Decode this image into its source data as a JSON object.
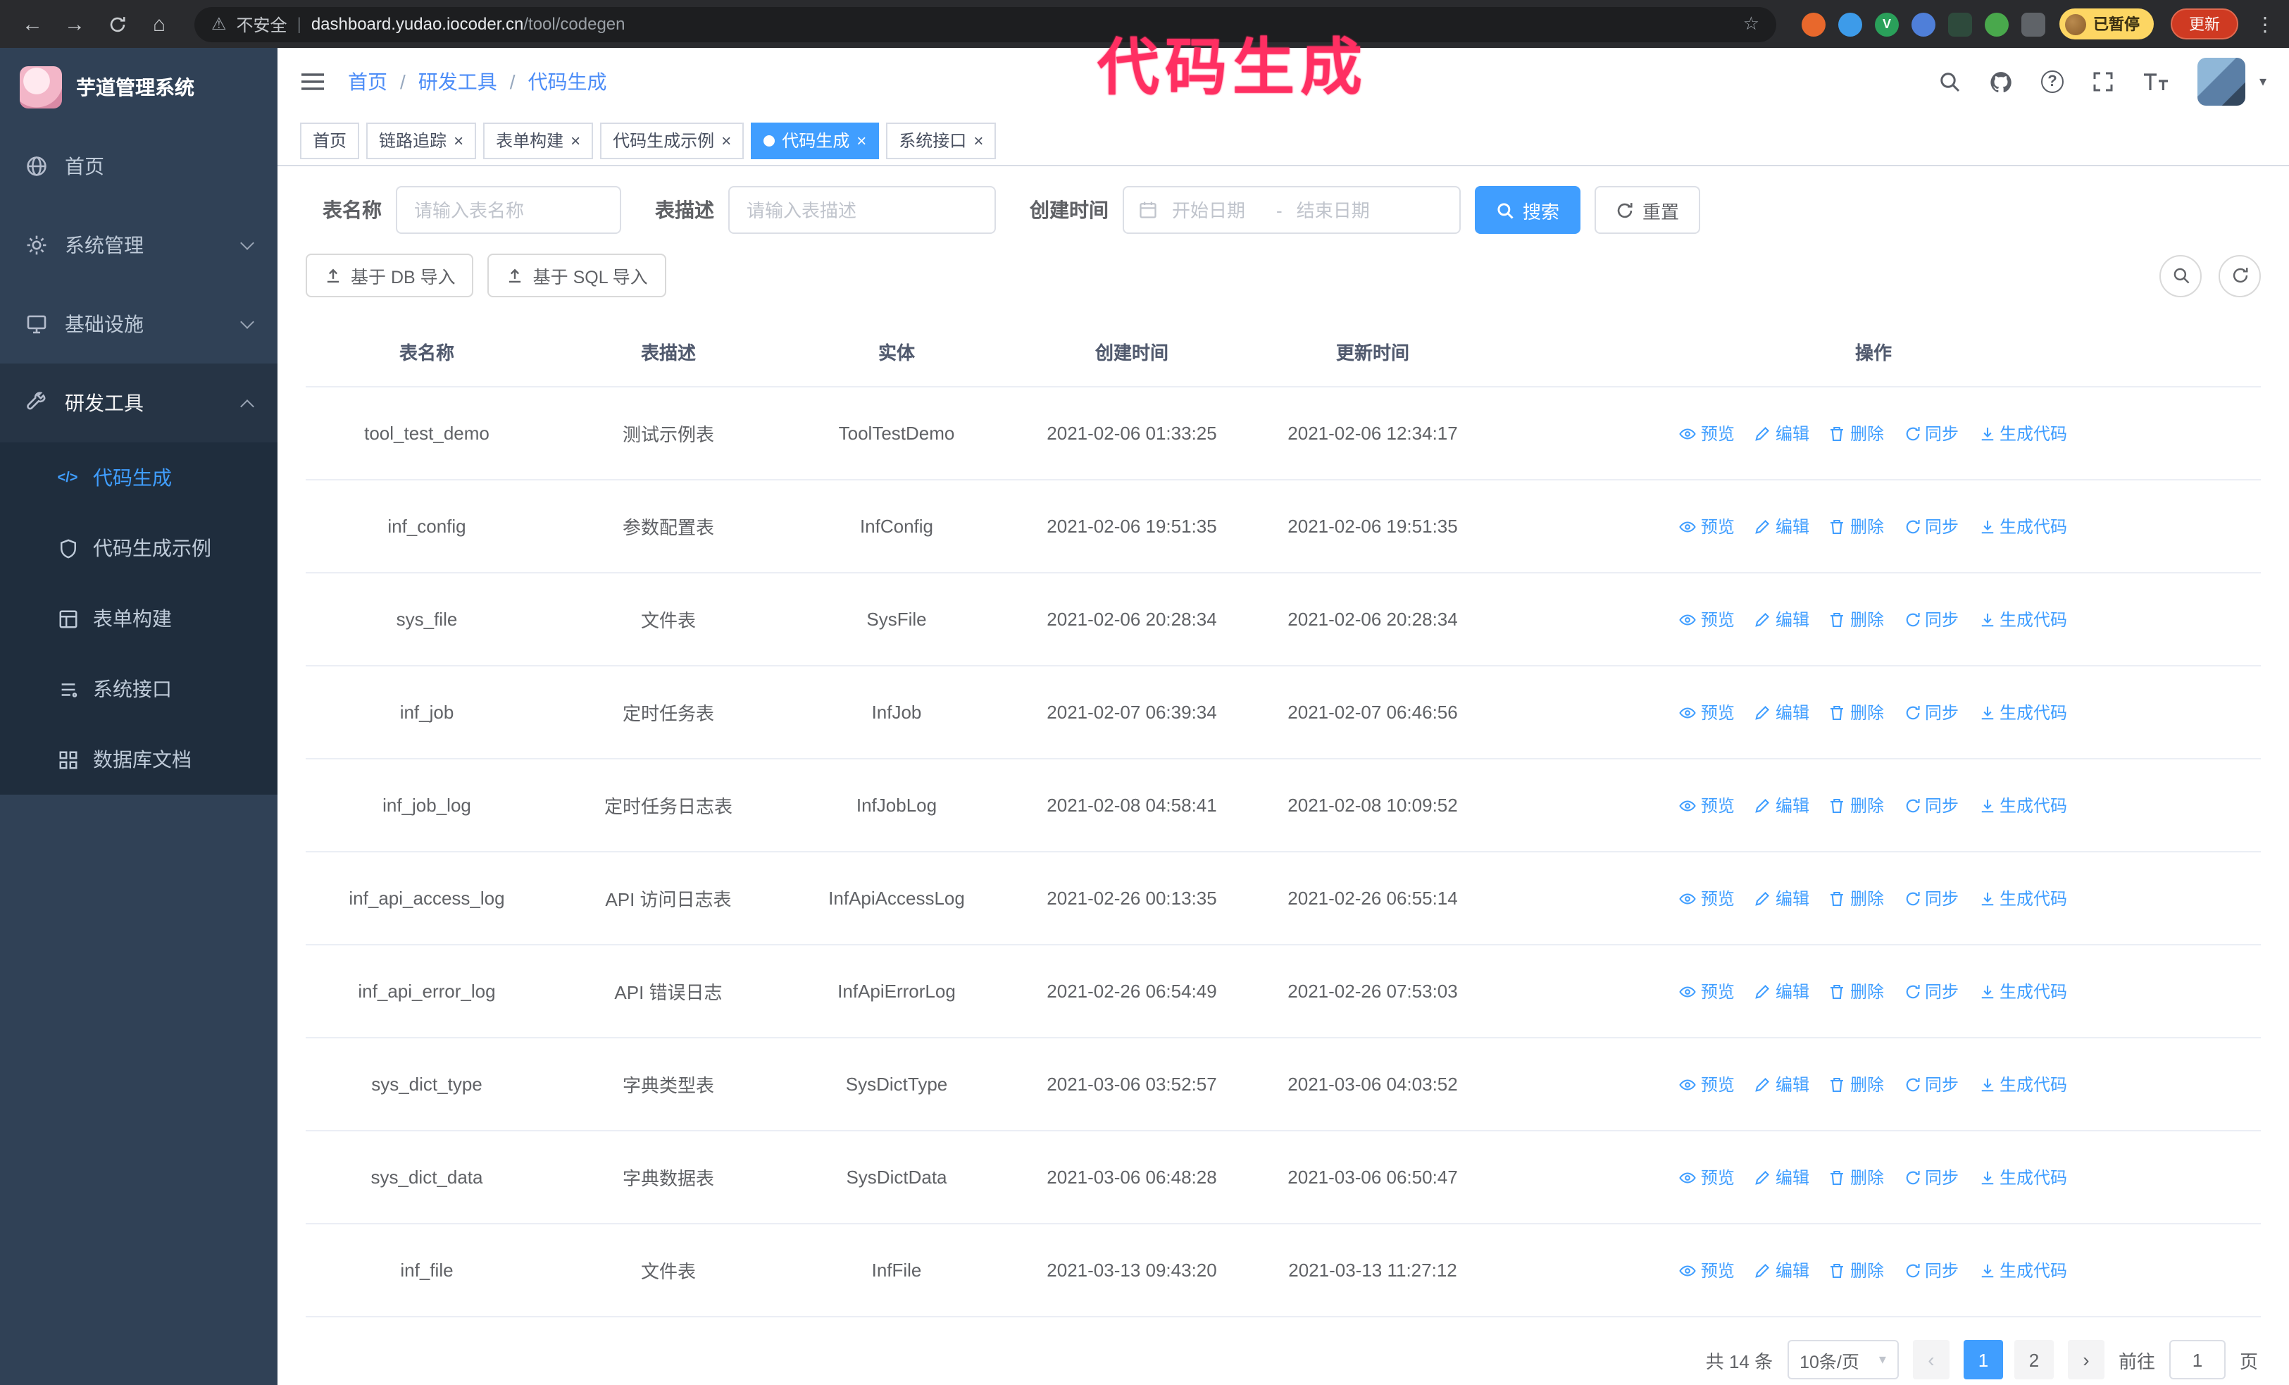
{
  "browser": {
    "security_label": "不安全",
    "url_host": "dashboard.yudao.iocoder.cn",
    "url_path": "/tool/codegen",
    "paused_badge": "已暂停",
    "update_button": "更新"
  },
  "annotation": "代码生成",
  "colors": {
    "primary": "#409eff",
    "annotation": "#ff2f62",
    "sidebar_bg": "#304156",
    "submenu_bg": "#1f2d3d",
    "tag_active": "#409eff"
  },
  "icons": {
    "back": "←",
    "forward": "→",
    "home": "⌂",
    "warning": "⚠",
    "star": "☆",
    "kebab": "⋮",
    "divider": "|",
    "close": "×",
    "separator": "/",
    "caret": "▾",
    "prev": "‹",
    "next": "›",
    "question": "?",
    "code": "</>"
  },
  "sidebar": {
    "app_title": "芋道管理系统",
    "items": [
      {
        "label": "首页"
      },
      {
        "label": "系统管理"
      },
      {
        "label": "基础设施"
      },
      {
        "label": "研发工具"
      }
    ],
    "sub_items": [
      {
        "label": "代码生成"
      },
      {
        "label": "代码生成示例"
      },
      {
        "label": "表单构建"
      },
      {
        "label": "系统接口"
      },
      {
        "label": "数据库文档"
      }
    ]
  },
  "header": {
    "breadcrumb": [
      "首页",
      "研发工具",
      "代码生成"
    ]
  },
  "tabs": [
    {
      "label": "首页",
      "closable": false,
      "active": false
    },
    {
      "label": "链路追踪",
      "closable": true,
      "active": false
    },
    {
      "label": "表单构建",
      "closable": true,
      "active": false
    },
    {
      "label": "代码生成示例",
      "closable": true,
      "active": false
    },
    {
      "label": "代码生成",
      "closable": true,
      "active": true
    },
    {
      "label": "系统接口",
      "closable": true,
      "active": false
    }
  ],
  "filters": {
    "table_name_label": "表名称",
    "table_name_placeholder": "请输入表名称",
    "table_desc_label": "表描述",
    "table_desc_placeholder": "请输入表描述",
    "create_time_label": "创建时间",
    "start_date_placeholder": "开始日期",
    "range_separator": "-",
    "end_date_placeholder": "结束日期",
    "search_button": "搜索",
    "reset_button": "重置"
  },
  "toolbar": {
    "import_db_button": "基于 DB 导入",
    "import_sql_button": "基于 SQL 导入"
  },
  "table": {
    "columns": [
      "表名称",
      "表描述",
      "实体",
      "创建时间",
      "更新时间",
      "操作"
    ],
    "actions": [
      "预览",
      "编辑",
      "删除",
      "同步",
      "生成代码"
    ],
    "rows": [
      {
        "name": "tool_test_demo",
        "desc": "测试示例表",
        "entity": "ToolTestDemo",
        "created": "2021-02-06 01:33:25",
        "updated": "2021-02-06 12:34:17"
      },
      {
        "name": "inf_config",
        "desc": "参数配置表",
        "entity": "InfConfig",
        "created": "2021-02-06 19:51:35",
        "updated": "2021-02-06 19:51:35"
      },
      {
        "name": "sys_file",
        "desc": "文件表",
        "entity": "SysFile",
        "created": "2021-02-06 20:28:34",
        "updated": "2021-02-06 20:28:34"
      },
      {
        "name": "inf_job",
        "desc": "定时任务表",
        "entity": "InfJob",
        "created": "2021-02-07 06:39:34",
        "updated": "2021-02-07 06:46:56"
      },
      {
        "name": "inf_job_log",
        "desc": "定时任务日志表",
        "entity": "InfJobLog",
        "created": "2021-02-08 04:58:41",
        "updated": "2021-02-08 10:09:52"
      },
      {
        "name": "inf_api_access_log",
        "desc": "API 访问日志表",
        "entity": "InfApiAccessLog",
        "created": "2021-02-26 00:13:35",
        "updated": "2021-02-26 06:55:14"
      },
      {
        "name": "inf_api_error_log",
        "desc": "API 错误日志",
        "entity": "InfApiErrorLog",
        "created": "2021-02-26 06:54:49",
        "updated": "2021-02-26 07:53:03"
      },
      {
        "name": "sys_dict_type",
        "desc": "字典类型表",
        "entity": "SysDictType",
        "created": "2021-03-06 03:52:57",
        "updated": "2021-03-06 04:03:52"
      },
      {
        "name": "sys_dict_data",
        "desc": "字典数据表",
        "entity": "SysDictData",
        "created": "2021-03-06 06:48:28",
        "updated": "2021-03-06 06:50:47"
      },
      {
        "name": "inf_file",
        "desc": "文件表",
        "entity": "InfFile",
        "created": "2021-03-13 09:43:20",
        "updated": "2021-03-13 11:27:12"
      }
    ]
  },
  "pagination": {
    "total": "共 14 条",
    "page_size": "10条/页",
    "pages": [
      {
        "label": "1",
        "active": true
      },
      {
        "label": "2",
        "active": false
      }
    ],
    "goto_label": "前往",
    "goto_value": "1",
    "goto_suffix": "页"
  }
}
